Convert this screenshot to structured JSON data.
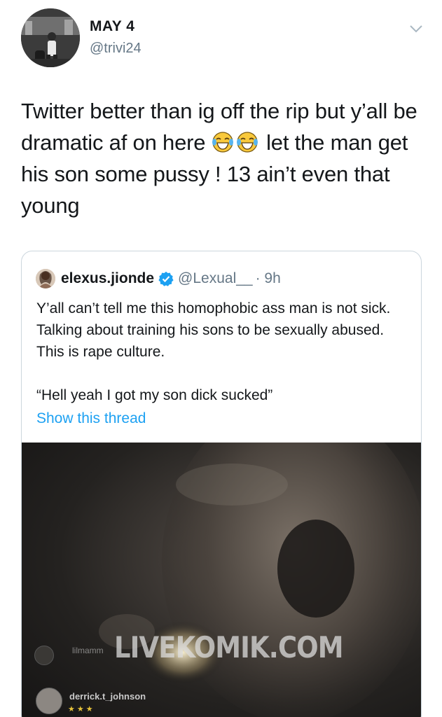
{
  "header": {
    "date": "MAY 4",
    "handle": "@trivi24"
  },
  "tweet": {
    "text_part1": "Twitter better than ig off the rip but y’all be dramatic af on here ",
    "emoji": [
      "face-with-tears-of-joy",
      "face-with-tears-of-joy"
    ],
    "text_part2": " let the man get his son some pussy ! 13 ain’t even that young"
  },
  "quoted_tweet": {
    "name": "elexus.jionde",
    "handle": "@Lexual__",
    "time": "· 9h",
    "text_line1": "Y’all can’t tell me this homophobic ass man is not sick. Talking about training his sons to be sexually abused. This is rape culture.",
    "text_line2": "“Hell yeah I got my son dick sucked”",
    "show_thread": "Show this thread",
    "media": {
      "watermark": "LIVEKOMIK.COM",
      "overlay_user1": "lilmamm",
      "overlay_user2": "derrick.t_johnson",
      "stars": "★★★"
    }
  },
  "colors": {
    "text": "#14171a",
    "muted": "#657786",
    "link": "#1da1f2",
    "border": "#ccd6dd",
    "verified": "#1da1f2"
  }
}
